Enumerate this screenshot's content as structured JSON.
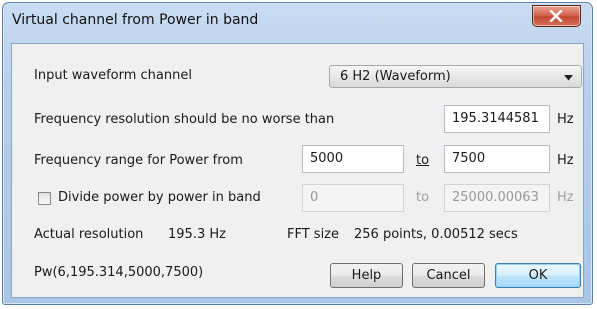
{
  "window": {
    "title": "Virtual channel from Power in band"
  },
  "input_channel": {
    "label": "Input waveform channel",
    "selected": "6 H2 (Waveform)"
  },
  "freq_resolution": {
    "label": "Frequency resolution should be no worse than",
    "value": "195.3144581",
    "unit": "Hz"
  },
  "freq_range": {
    "label": "Frequency range for Power from",
    "from_value": "5000",
    "to_label": "to",
    "to_value": "7500",
    "unit": "Hz"
  },
  "divide_power": {
    "label": "Divide power by power in band",
    "checked": false,
    "from_value": "0",
    "to_label": "to",
    "to_value": "25000.00063",
    "unit": "Hz"
  },
  "info": {
    "actual_resolution_label": "Actual resolution",
    "actual_resolution_value": "195.3 Hz",
    "fft_size_label": "FFT size",
    "fft_size_value": "256 points, 0.00512 secs",
    "expression": "Pw(6,195.314,5000,7500)"
  },
  "buttons": {
    "help": "Help",
    "cancel": "Cancel",
    "ok": "OK"
  },
  "colors": {
    "title_bar": "#b7cfeb",
    "close_button": "#c9503a",
    "dialog_background": "#f0f0f0",
    "ok_button_highlight": "#bee6fd",
    "disabled_text": "#a0a0a0"
  }
}
